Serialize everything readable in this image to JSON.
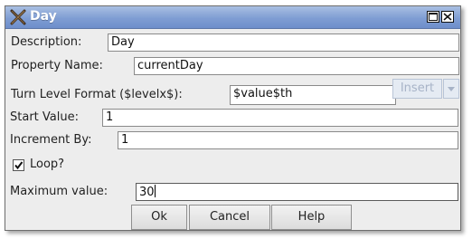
{
  "window": {
    "title": "Day"
  },
  "form": {
    "description_label": "Description:",
    "description_value": "Day",
    "property_label": "Property Name:",
    "property_value": "currentDay",
    "format_label": "Turn Level Format ($levelx$):",
    "format_value": "$value$th",
    "insert_label": "Insert",
    "start_label": "Start Value:",
    "start_value": "1",
    "increment_label": "Increment By:",
    "increment_value": "1",
    "loop_label": "Loop?",
    "loop_checked": true,
    "max_label": "Maximum value:",
    "max_value": "30"
  },
  "buttons": {
    "ok": "Ok",
    "cancel": "Cancel",
    "help": "Help"
  },
  "colors": {
    "titlebar": "#7f9dd3",
    "dialog_bg": "#ededed",
    "disabled_text": "#a7b3c7"
  },
  "icons": {
    "title": "crossed-tools-icon",
    "maximize": "maximize-icon",
    "close": "close-icon",
    "dropdown": "chevron-down-icon",
    "check": "checkmark-icon"
  }
}
